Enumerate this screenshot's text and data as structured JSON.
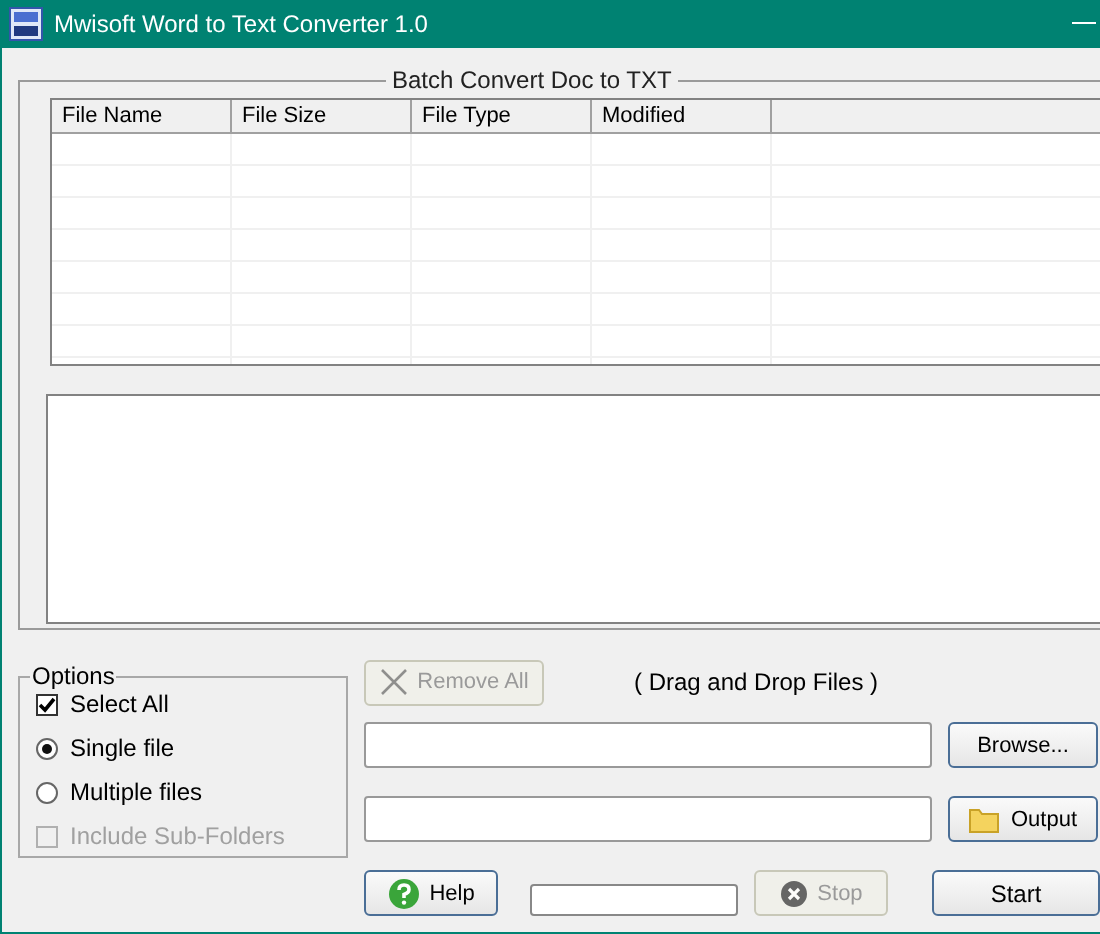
{
  "window": {
    "title": "Mwisoft Word to Text Converter 1.0"
  },
  "group": {
    "title": "Batch Convert  Doc to TXT"
  },
  "table": {
    "columns": [
      "File Name",
      "File Size",
      "File Type",
      "Modified"
    ]
  },
  "options": {
    "title": "Options",
    "items": [
      {
        "kind": "checkbox",
        "label": "Select All",
        "checked": true,
        "disabled": false
      },
      {
        "kind": "radio",
        "label": "Single file",
        "selected": true,
        "disabled": false
      },
      {
        "kind": "radio",
        "label": "Multiple files",
        "selected": false,
        "disabled": false
      },
      {
        "kind": "checkbox",
        "label": "Include Sub-Folders",
        "checked": false,
        "disabled": true
      }
    ]
  },
  "remove_all": {
    "label": "Remove All",
    "disabled": true
  },
  "drop_hint": "( Drag and Drop  Files )",
  "browse": {
    "label": "Browse..."
  },
  "output": {
    "label": "Output"
  },
  "help": {
    "label": "Help"
  },
  "progress": {
    "level": 0
  },
  "stop": {
    "label": "Stop",
    "disabled": true
  },
  "start": {
    "label": "Start"
  }
}
